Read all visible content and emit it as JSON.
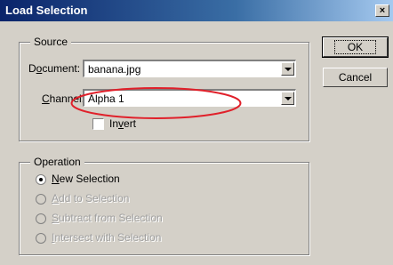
{
  "dialog": {
    "title": "Load Selection",
    "close_symbol": "×"
  },
  "source": {
    "group_label": "Source",
    "document_label_pre": "D",
    "document_label_ul": "o",
    "document_label_post": "cument:",
    "document_value": "banana.jpg",
    "channel_label_pre": "",
    "channel_label_ul": "C",
    "channel_label_post": "hannel:",
    "channel_value": "Alpha 1",
    "invert_pre": "In",
    "invert_ul": "v",
    "invert_post": "ert",
    "invert_checked": false
  },
  "operation": {
    "group_label": "Operation",
    "options": [
      {
        "ul": "N",
        "rest": "ew Selection",
        "checked": true,
        "enabled": true
      },
      {
        "ul": "A",
        "rest": "dd to Selection",
        "checked": false,
        "enabled": false
      },
      {
        "ul": "S",
        "rest": "ubtract from Selection",
        "checked": false,
        "enabled": false
      },
      {
        "ul": "I",
        "rest": "ntersect with Selection",
        "checked": false,
        "enabled": false
      }
    ]
  },
  "buttons": {
    "ok": "OK",
    "cancel": "Cancel"
  },
  "annotation": {
    "ellipse_color": "#e0202a"
  }
}
